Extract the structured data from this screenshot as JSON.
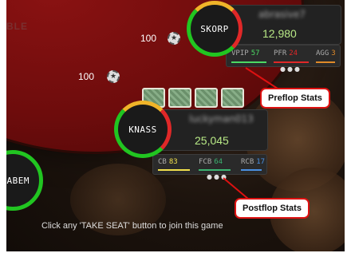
{
  "table": {
    "label_fragment": "BLE",
    "footer_text": "Click any 'TAKE SEAT' button to join this game"
  },
  "bets": [
    {
      "amount": "100"
    },
    {
      "amount": "100"
    }
  ],
  "players": {
    "skorp": {
      "avatar_name": "SKORP",
      "screen_name": "abrasive7",
      "stack": "12,980",
      "preflop": {
        "vpip_label": "VPIP",
        "vpip_value": "57",
        "pfr_label": "PFR",
        "pfr_value": "24",
        "agg_label": "AGG",
        "agg_value": "3"
      }
    },
    "knass": {
      "avatar_name": "KNASS",
      "screen_name": "luckyman013",
      "stack": "25,045",
      "postflop": {
        "cb_label": "CB",
        "cb_value": "83",
        "fcb_label": "FCB",
        "fcb_value": "64",
        "rcb_label": "RCB",
        "rcb_value": "17"
      }
    },
    "sabem": {
      "avatar_name": "SABEM"
    }
  },
  "callouts": {
    "preflop": "Preflop Stats",
    "postflop": "Postflop Stats"
  },
  "colors": {
    "felt": "#7a0f0f",
    "stack": "#b8e986",
    "vpip": "#4cd964",
    "pfr": "#e02828",
    "agg": "#e08a28",
    "cb": "#f2e14c",
    "fcb": "#3cb371",
    "rcb": "#4a90e2",
    "callout_border": "#dd1111"
  }
}
